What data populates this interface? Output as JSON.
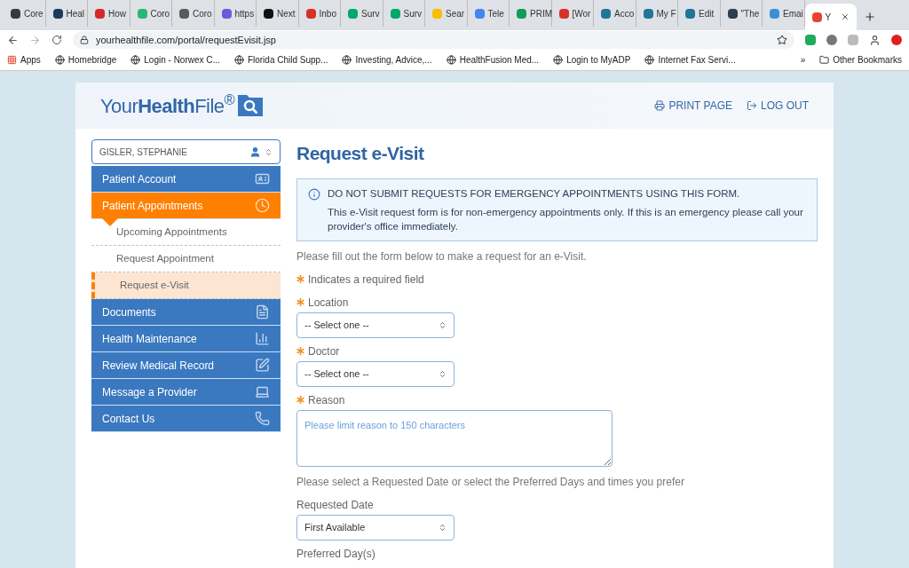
{
  "browser": {
    "tabs": [
      {
        "label": "Core",
        "color": "#3a3a3a",
        "selected": false
      },
      {
        "label": "Heal",
        "color": "#1b3b5a",
        "selected": false
      },
      {
        "label": "How",
        "color": "#d62828",
        "selected": false
      },
      {
        "label": "Coro",
        "color": "#2bb673",
        "selected": false
      },
      {
        "label": "Coro",
        "color": "#5a5a5a",
        "selected": false
      },
      {
        "label": "https",
        "color": "#6b5bd6",
        "selected": false
      },
      {
        "label": "Next",
        "color": "#111111",
        "selected": false
      },
      {
        "label": "Inbo",
        "color": "#d93025",
        "selected": false
      },
      {
        "label": "Surv",
        "color": "#00a86b",
        "selected": false
      },
      {
        "label": "Surv",
        "color": "#00a86b",
        "selected": false
      },
      {
        "label": "Sear",
        "color": "#fbbc04",
        "selected": false
      },
      {
        "label": "Tele",
        "color": "#4285f4",
        "selected": false
      },
      {
        "label": "PRIM",
        "color": "#0f9d58",
        "selected": false
      },
      {
        "label": "[Wor",
        "color": "#d93025",
        "selected": false
      },
      {
        "label": "Acco",
        "color": "#21759b",
        "selected": false
      },
      {
        "label": "My F",
        "color": "#21759b",
        "selected": false
      },
      {
        "label": "Edit",
        "color": "#21759b",
        "selected": false
      },
      {
        "label": "\"The",
        "color": "#2d3e50",
        "selected": false
      },
      {
        "label": "Emai",
        "color": "#3b8fd9",
        "selected": false
      },
      {
        "label": "Y",
        "color": "#e8442e",
        "selected": true
      }
    ],
    "url": "yourhealthfile.com/portal/requestEvisit.jsp",
    "bookmarks": [
      "Apps",
      "Homebridge",
      "Login - Norwex C...",
      "Florida Child Supp...",
      "Investing, Advice,...",
      "HealthFusion Med...",
      "Login to MyADP",
      "Internet Fax Servi..."
    ],
    "more_bookmarks": "»",
    "other_bookmarks": "Other Bookmarks"
  },
  "header": {
    "logo": "Your**Health**File$^{®}$",
    "actions": [
      "PRINT PAGE",
      "LOG OUT"
    ]
  },
  "sidebar": {
    "patient": "GISLER, STEPHANIE",
    "items": [
      {
        "label": "Patient Account",
        "selected": false
      },
      {
        "label": "Patient Appointments",
        "selected": true,
        "expanded": true,
        "children": [
          {
            "label": "Upcoming Appointments",
            "selected": false
          },
          {
            "label": "Request Appointment",
            "selected": false
          },
          {
            "label": "Request e-Visit",
            "selected": true
          }
        ]
      },
      {
        "label": "Documents",
        "selected": false
      },
      {
        "label": "Health Maintenance",
        "selected": false
      },
      {
        "label": "Review Medical Record",
        "selected": false
      },
      {
        "label": "Message a Provider",
        "selected": false
      },
      {
        "label": "Contact Us",
        "selected": false
      }
    ]
  },
  "main": {
    "title": "Request e-Visit",
    "alert": {
      "heading": "DO NOT SUBMIT REQUESTS FOR EMERGENCY APPOINTMENTS USING THIS FORM.",
      "body": "This e-Visit request form is for non-emergency appointments only. If this is an emergency please call your provider's office immediately."
    },
    "intro": "Please fill out the form below to make a request for an e-Visit.",
    "required_note": "Indicates a required field",
    "fields": [
      {
        "kind": "select",
        "label": "Location",
        "required": true,
        "value": "-- Select one --"
      },
      {
        "kind": "select",
        "label": "Doctor",
        "required": true,
        "value": "-- Select one --"
      },
      {
        "kind": "textarea",
        "label": "Reason",
        "required": true,
        "placeholder": "Please limit reason to 150 characters"
      }
    ],
    "date_note": "Please select a Requested Date or select the Preferred Days and times you prefer",
    "date_fields": [
      {
        "kind": "select",
        "label": "Requested Date",
        "required": false,
        "value": "First Available"
      },
      {
        "kind": "heading",
        "label": "Preferred Day(s)",
        "required": false
      }
    ]
  }
}
